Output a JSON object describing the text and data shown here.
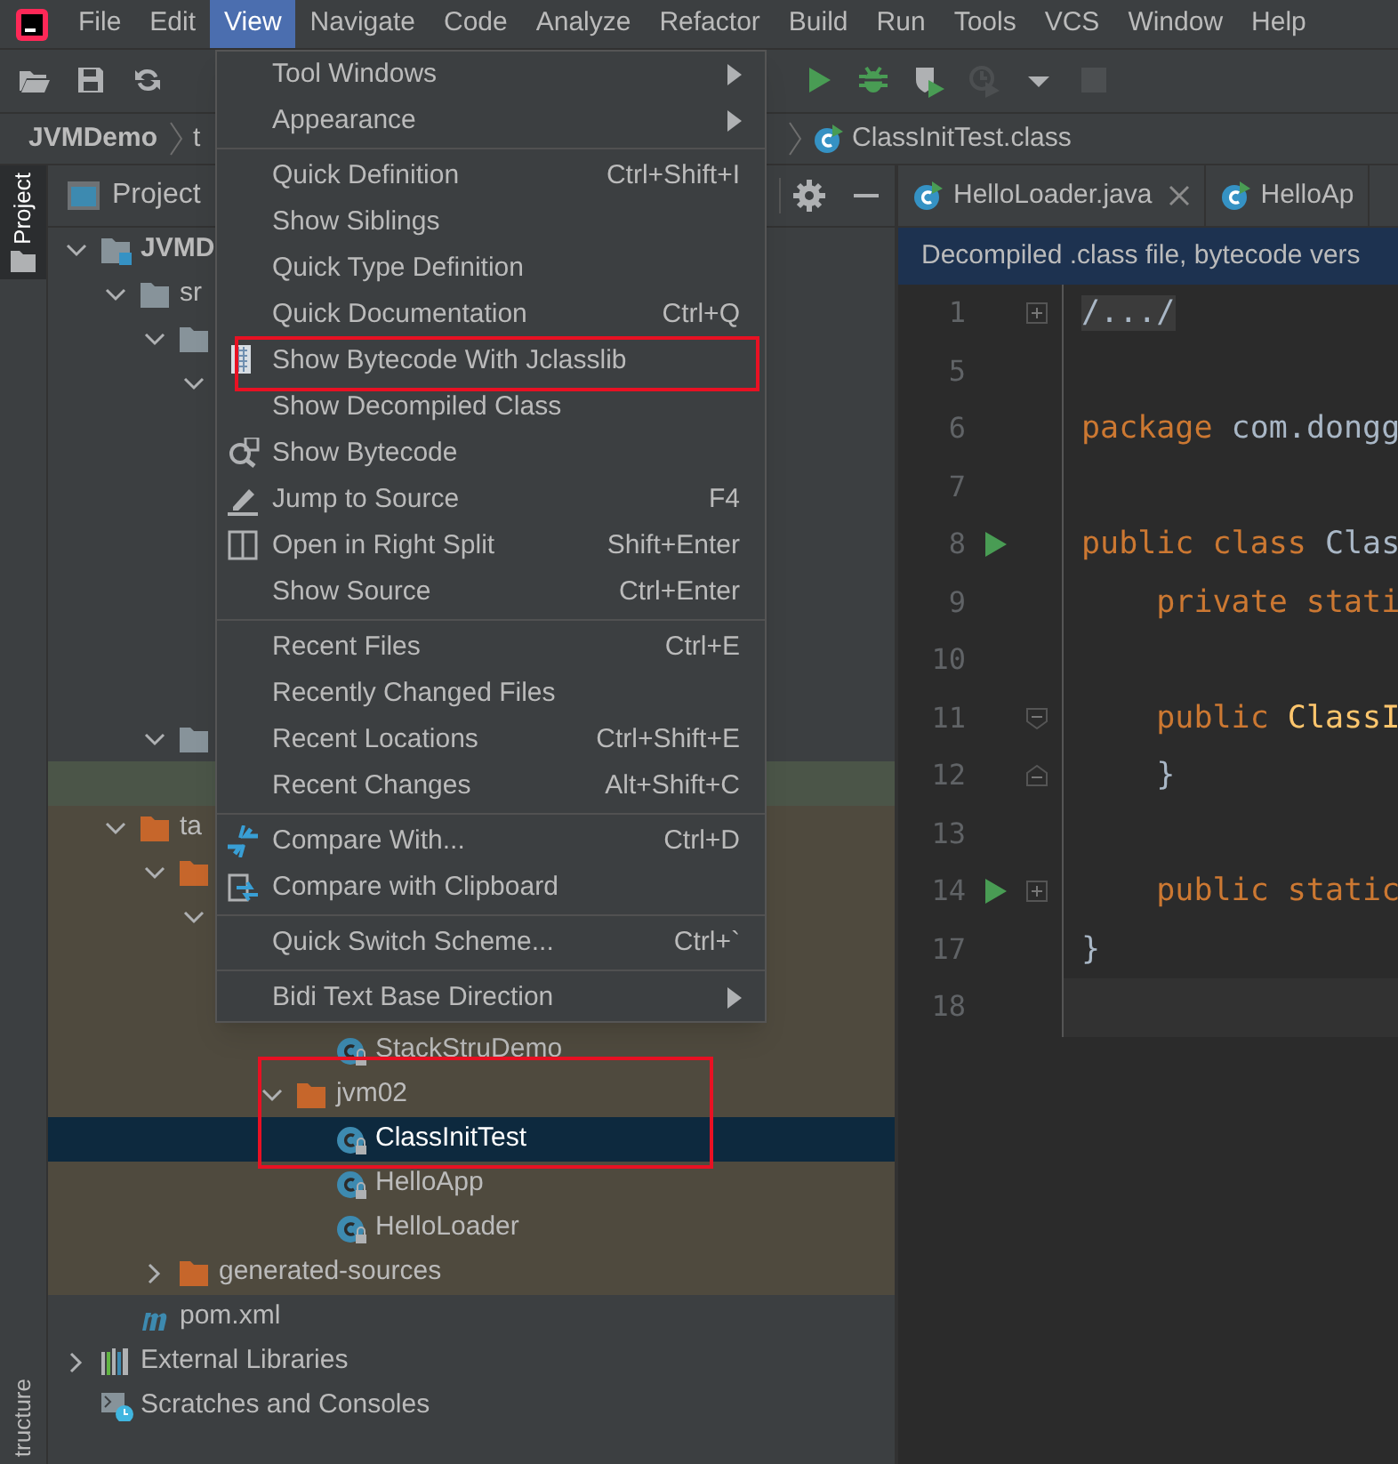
{
  "menu_bar": {
    "items": [
      {
        "label": "File",
        "selected": false
      },
      {
        "label": "Edit",
        "selected": false
      },
      {
        "label": "View",
        "selected": true
      },
      {
        "label": "Navigate",
        "selected": false
      },
      {
        "label": "Code",
        "selected": false
      },
      {
        "label": "Analyze",
        "selected": false
      },
      {
        "label": "Refactor",
        "selected": false
      },
      {
        "label": "Build",
        "selected": false
      },
      {
        "label": "Run",
        "selected": false
      },
      {
        "label": "Tools",
        "selected": false
      },
      {
        "label": "VCS",
        "selected": false
      },
      {
        "label": "Window",
        "selected": false
      },
      {
        "label": "Help",
        "selected": false
      }
    ]
  },
  "toolbar": {
    "left": [
      {
        "kind": "open",
        "disabled": false
      },
      {
        "kind": "save",
        "disabled": false
      },
      {
        "kind": "sync",
        "disabled": false
      }
    ],
    "right": [
      {
        "kind": "run",
        "disabled": false
      },
      {
        "kind": "debug",
        "disabled": false
      },
      {
        "kind": "coverage",
        "disabled": false
      },
      {
        "kind": "profile",
        "disabled": true
      },
      {
        "kind": "dropdown",
        "disabled": false
      },
      {
        "kind": "stop",
        "disabled": true
      }
    ]
  },
  "breadcrumbs": [
    {
      "kind": "module",
      "label": "JVMDemo"
    },
    {
      "kind": "folder",
      "label": "t"
    },
    {
      "kind": "class",
      "label": "ClassInitTest.class"
    }
  ],
  "side_tabs": [
    {
      "label": "Project",
      "selected": true
    },
    {
      "label": "tructure",
      "selected": false
    }
  ],
  "project_panel": {
    "title": "Project",
    "tree": [
      {
        "label": "JVMD",
        "kind": "module",
        "expanded": true,
        "selected": false,
        "children": [
          {
            "label": "sr",
            "kind": "folder",
            "expanded": true,
            "selected": false,
            "children": [
              {
                "kind": "folder",
                "expanded": true,
                "selected": false,
                "children": [
                  {
                    "expanded": true,
                    "selected": false
                  }
                ]
              },
              {
                "kind": "folder",
                "expanded": true,
                "selected": false,
                "children": [
                  {
                    "highlighted": true,
                    "selected": false
                  }
                ]
              }
            ]
          },
          {
            "label": "ta",
            "kind": "folder-orange",
            "expanded": true,
            "excluded": true,
            "selected": false,
            "children": [
              {
                "kind": "folder-orange",
                "expanded": true,
                "selected": false,
                "children": [
                  {
                    "expanded": true,
                    "selected": false,
                    "children": [
                      {
                        "selected": false,
                        "children": [
                          {
                            "selected": false,
                            "children": [
                              {
                                "label": "StackStruDemo",
                                "kind": "class",
                                "selected": false
                              }
                            ]
                          },
                          {
                            "label": "jvm02",
                            "kind": "folder-orange",
                            "expanded": true,
                            "highlighted_box": true,
                            "selected": false,
                            "children": [
                              {
                                "label": "ClassInitTest",
                                "kind": "class",
                                "selected": true
                              },
                              {
                                "label": "HelloApp",
                                "kind": "class",
                                "selected": false
                              },
                              {
                                "label": "HelloLoader",
                                "kind": "class",
                                "selected": false
                              }
                            ]
                          }
                        ]
                      }
                    ]
                  }
                ]
              },
              {
                "label": "generated-sources",
                "kind": "folder-orange",
                "expanded": false,
                "selected": false
              }
            ]
          },
          {
            "label": "pom.xml",
            "kind": "maven",
            "selected": false
          }
        ]
      },
      {
        "label": "External Libraries",
        "kind": "libraries",
        "expanded": false,
        "selected": false
      },
      {
        "label": "Scratches and Consoles",
        "kind": "scratches",
        "selected": false
      }
    ]
  },
  "editor": {
    "tabs": [
      {
        "label": "HelloLoader.java",
        "closable": true
      },
      {
        "label": "HelloAp",
        "closable": false
      }
    ],
    "banner": "Decompiled .class file, bytecode vers",
    "lines": [
      {
        "number": "1",
        "run": false,
        "kind": "fold-plus",
        "tokens": [
          {
            "kind": "folded",
            "text": "/.../"
          }
        ]
      },
      {
        "number": "5",
        "run": false
      },
      {
        "number": "6",
        "run": false,
        "tokens": [
          {
            "kind": "keyword",
            "text": "package "
          },
          {
            "kind": "plain",
            "text": "com.dongg"
          }
        ]
      },
      {
        "number": "7",
        "run": false
      },
      {
        "number": "8",
        "run": true,
        "tokens": [
          {
            "kind": "keyword",
            "text": "public class "
          },
          {
            "kind": "plain",
            "text": "Clas"
          }
        ]
      },
      {
        "number": "9",
        "run": false,
        "tokens": [
          {
            "kind": "keyword",
            "text": "    private stati"
          }
        ]
      },
      {
        "number": "10",
        "run": false
      },
      {
        "number": "11",
        "run": false,
        "kind": "fold-start",
        "tokens": [
          {
            "kind": "keyword",
            "text": "    public "
          },
          {
            "kind": "method",
            "text": "ClassI"
          }
        ]
      },
      {
        "number": "12",
        "run": false,
        "kind": "fold-end",
        "tokens": [
          {
            "kind": "plain",
            "text": "    }"
          }
        ]
      },
      {
        "number": "13",
        "run": false
      },
      {
        "number": "14",
        "run": true,
        "kind": "fold-plus",
        "tokens": [
          {
            "kind": "keyword",
            "text": "    public static"
          }
        ]
      },
      {
        "number": "17",
        "run": false,
        "tokens": [
          {
            "kind": "plain",
            "text": "}"
          }
        ]
      },
      {
        "number": "18",
        "run": false,
        "current": true
      }
    ]
  },
  "view_menu": {
    "items": [
      {
        "kind": "submenu",
        "label": "Tool Windows"
      },
      {
        "kind": "submenu",
        "label": "Appearance"
      },
      {
        "kind": "separator"
      },
      {
        "kind": "item",
        "label": "Quick Definition",
        "shortcut": "Ctrl+Shift+I"
      },
      {
        "kind": "item",
        "label": "Show Siblings"
      },
      {
        "kind": "item",
        "label": "Quick Type Definition"
      },
      {
        "kind": "item",
        "label": "Quick Documentation",
        "shortcut": "Ctrl+Q"
      },
      {
        "kind": "jclasslib",
        "label": "Show Bytecode With Jclasslib",
        "highlighted": true
      },
      {
        "kind": "item",
        "label": "Show Decompiled Class"
      },
      {
        "kind": "bytecode",
        "label": "Show Bytecode"
      },
      {
        "kind": "pencil",
        "label": "Jump to Source",
        "shortcut": "F4"
      },
      {
        "kind": "split",
        "label": "Open in Right Split",
        "shortcut": "Shift+Enter"
      },
      {
        "kind": "item",
        "label": "Show Source",
        "shortcut": "Ctrl+Enter"
      },
      {
        "kind": "separator"
      },
      {
        "kind": "item",
        "label": "Recent Files",
        "shortcut": "Ctrl+E"
      },
      {
        "kind": "item",
        "label": "Recently Changed Files"
      },
      {
        "kind": "item",
        "label": "Recent Locations",
        "shortcut": "Ctrl+Shift+E"
      },
      {
        "kind": "item",
        "label": "Recent Changes",
        "shortcut": "Alt+Shift+C"
      },
      {
        "kind": "separator"
      },
      {
        "kind": "compare",
        "label": "Compare With...",
        "shortcut": "Ctrl+D"
      },
      {
        "kind": "clipboard",
        "label": "Compare with Clipboard"
      },
      {
        "kind": "separator"
      },
      {
        "kind": "item",
        "label": "Quick Switch Scheme...",
        "shortcut": "Ctrl+`"
      },
      {
        "kind": "separator"
      },
      {
        "kind": "submenu",
        "label": "Bidi Text Base Direction"
      }
    ]
  }
}
